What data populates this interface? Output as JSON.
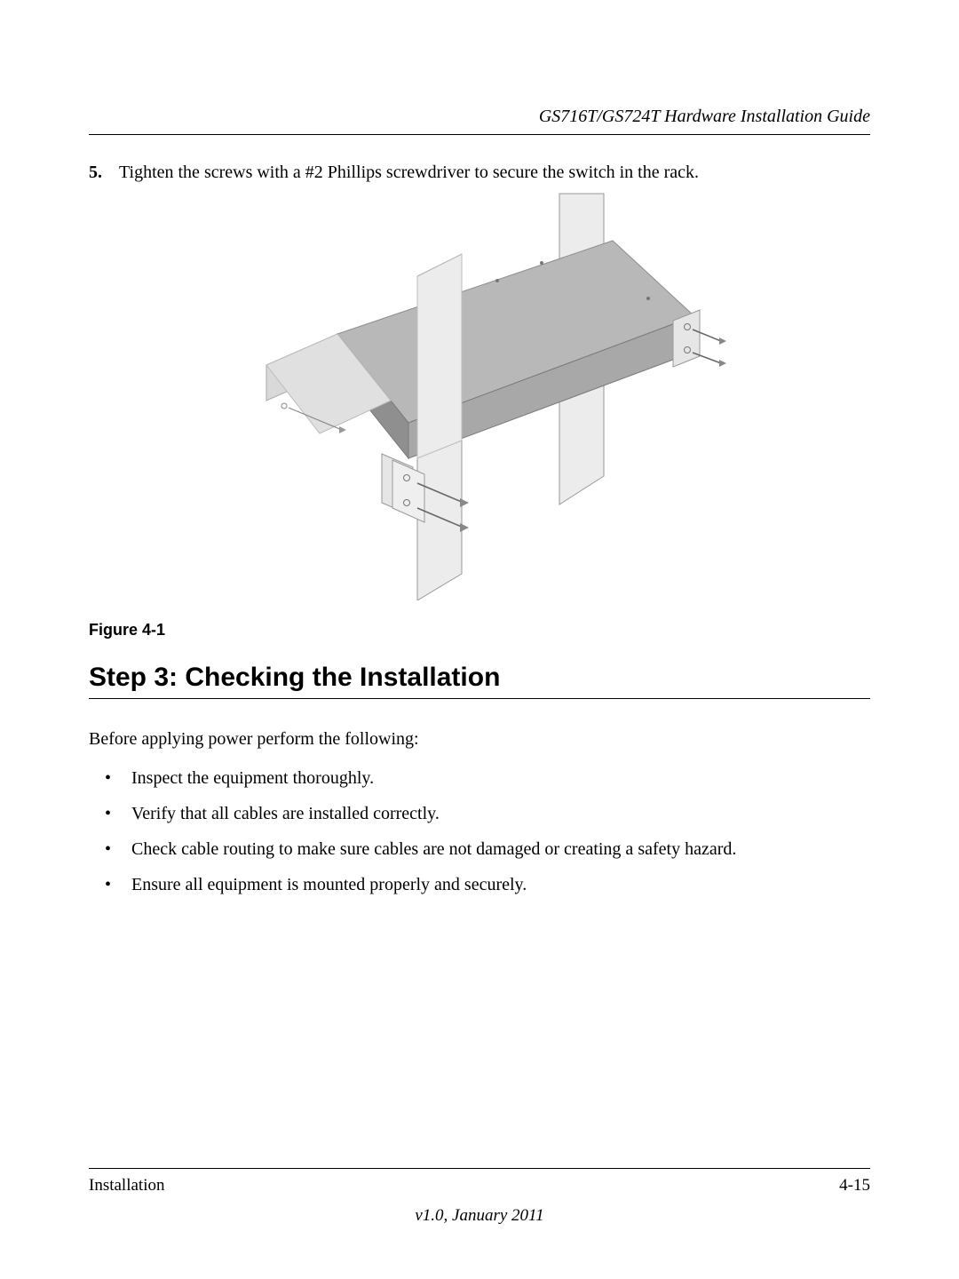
{
  "header": {
    "running_title": "GS716T/GS724T Hardware Installation Guide"
  },
  "step": {
    "number": "5.",
    "text": "Tighten the screws with a #2 Phillips screwdriver to secure the switch in the rack."
  },
  "figure": {
    "caption": "Figure 4-1"
  },
  "section": {
    "heading": "Step 3: Checking the Installation",
    "intro": "Before applying power perform the following:",
    "bullets": [
      "Inspect the equipment thoroughly.",
      "Verify that all cables are installed correctly.",
      "Check cable routing to make sure cables are not damaged or creating a safety hazard.",
      "Ensure all equipment is mounted properly and securely."
    ]
  },
  "footer": {
    "section": "Installation",
    "page": "4-15",
    "version": "v1.0, January 2011"
  }
}
